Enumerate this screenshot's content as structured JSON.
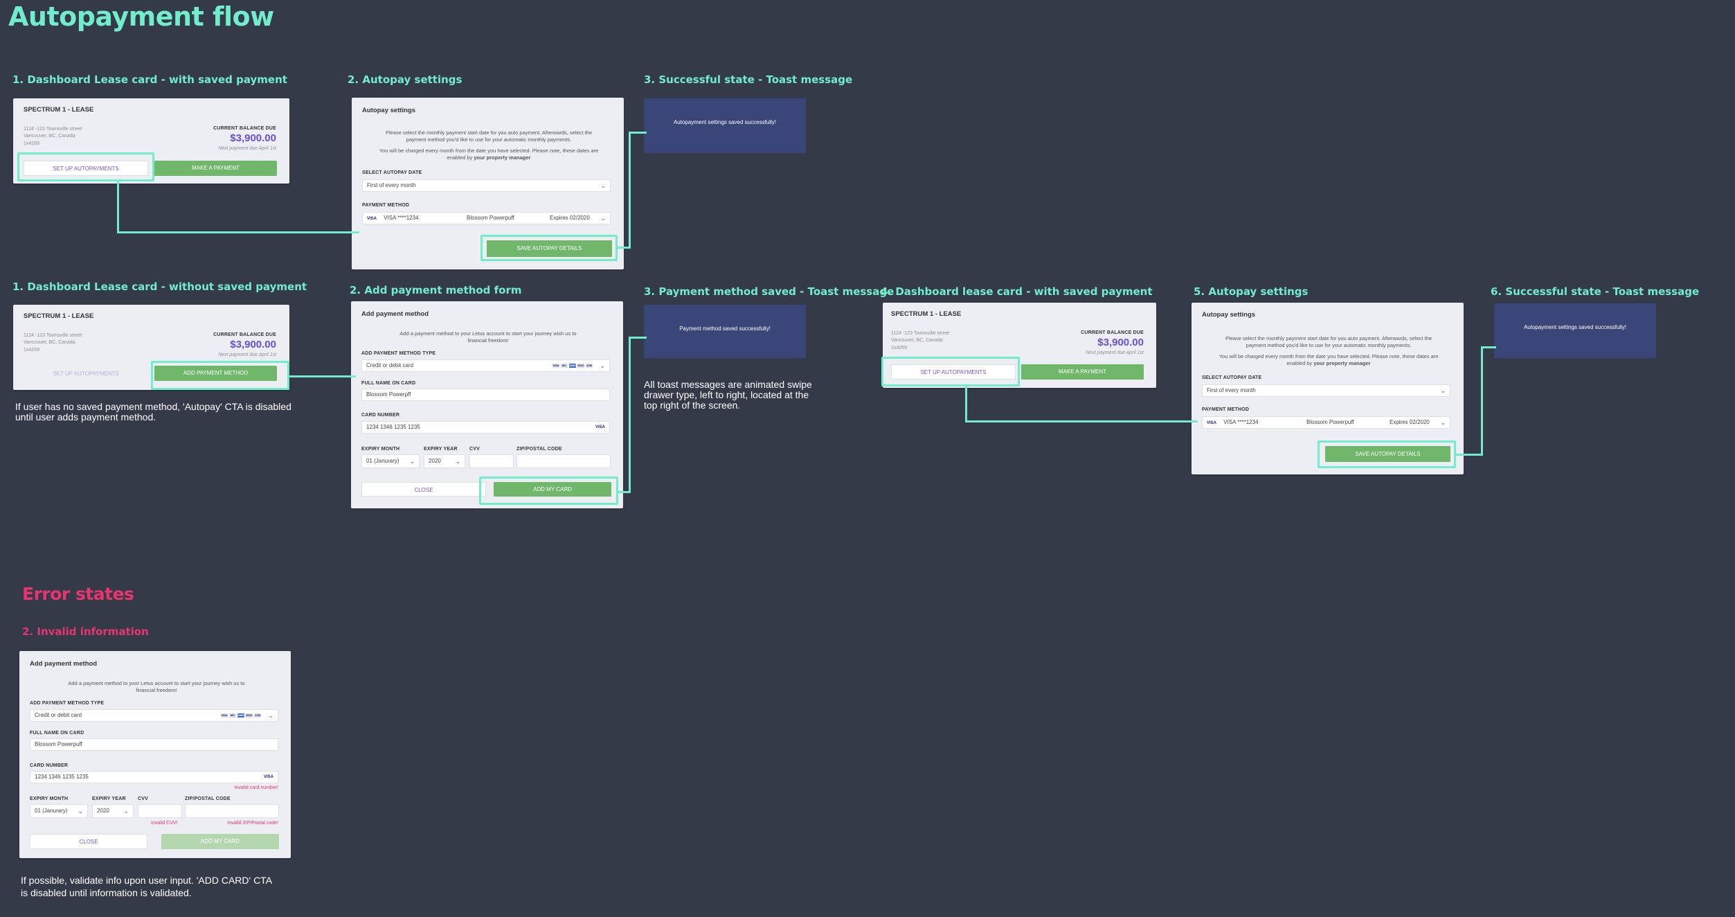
{
  "page_title": "Autopayment flow",
  "error_title": "Error states",
  "sections": {
    "s1": "1. Dashboard Lease card - with saved payment",
    "s2": "2. Autopay settings",
    "s3": "3. Successful state - Toast message",
    "r1": "1. Dashboard Lease card - without saved payment",
    "r2": "2. Add payment method form",
    "r3": "3. Payment method saved - Toast message",
    "r4": "4. Dashboard lease card - with saved payment",
    "r5": "5. Autopay settings",
    "r6": "6. Successful state - Toast message",
    "e2": "2. Invalid information"
  },
  "notes": {
    "no_payment": "If user has no saved payment method, 'Autopay' CTA is disabled until user adds payment method.",
    "toast": "All toast messages are animated swipe drawer type, left to right, located at the top right of the screen.",
    "validate": "If possible, validate info upon user input. 'ADD CARD' CTA is disabled until information is validated."
  },
  "lease": {
    "title": "SPECTRUM 1 - LEASE",
    "address1": "1124 -123 Townsville street",
    "address2": "Vancouver, BC, Canada",
    "postal": "1x4269",
    "balance_label": "CURRENT BALANCE DUE",
    "amount": "$3,900.00",
    "due": "Next payment due April 1st",
    "setup_autopay": "SET UP AUTOPAYMENTS",
    "make_payment": "MAKE A PAYMENT",
    "add_payment": "ADD PAYMENT METHOD"
  },
  "autopay": {
    "title": "Autopay settings",
    "para1": "Please select the monthly payment start date for you auto payment. Afterwards, select the payment method you'd like to use for your automatic monthly payments.",
    "para2a": "You will be charged every month from the date you have selected. Please note, these dates are enabled by",
    "para2b": "your property manager",
    "date_label": "SELECT AUTOPAY DATE",
    "date_value": "First of every month",
    "pm_label": "PAYMENT METHOD",
    "card_brand": "VISA",
    "card_number": "VISA ****1234",
    "card_name": "Blossom Powerpuff",
    "card_exp": "Expires 02/2020",
    "save": "SAVE AUTOPAY DETAILS"
  },
  "toasts": {
    "autopay_saved": "Autopayment settings saved successfully!",
    "payment_saved": "Payment method saved successfully!"
  },
  "form": {
    "title": "Add payment method",
    "intro": "Add a payment method to your Letus account to start your journey wish us to financial freedom!",
    "type_label": "ADD PAYMENT METHOD TYPE",
    "type_value": "Credit or debit card",
    "name_label": "FULL NAME ON CARD",
    "name_value": "Blossom Powerpff",
    "number_label": "CARD NUMBER",
    "number_value": "1234 1346 1235 1235",
    "exp_month_label": "EXPIRY MONTH",
    "exp_month_value": "01 (Janurary)",
    "exp_year_label": "EXPIRY YEAR",
    "exp_year_value": "2020",
    "cvv_label": "CVV",
    "zip_label": "ZIP/POSTAL CODE",
    "close": "CLOSE",
    "add": "ADD MY CARD",
    "brands": [
      "VISA",
      "MC",
      "AMEX",
      "DISC",
      "JCB"
    ]
  },
  "errors": {
    "card": "Invalid card number!",
    "cvv": "Invalid CVV!",
    "zip": "Invalid ZIP/Postal code!"
  }
}
